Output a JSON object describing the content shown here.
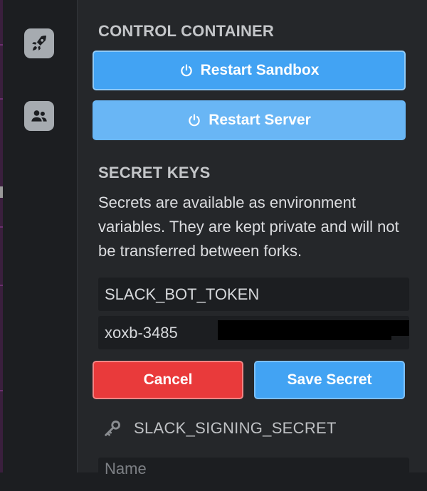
{
  "sidebar": {
    "items": [
      {
        "icon": "rocket-icon",
        "label": ""
      },
      {
        "icon": "users-icon",
        "label": ""
      }
    ]
  },
  "control_container": {
    "title": "CONTROL CONTAINER",
    "restart_sandbox_label": "Restart Sandbox",
    "restart_server_label": "Restart Server",
    "button_icon": "power-icon"
  },
  "secret_keys": {
    "title": "SECRET KEYS",
    "description": "Secrets are available as environment variables. They are kept private and will not be transferred between forks.",
    "key_value": "SLACK_BOT_TOKEN",
    "secret_value": "xoxb-3485",
    "cancel_label": "Cancel",
    "save_label": "Save Secret",
    "existing_secret_name": "SLACK_SIGNING_SECRET",
    "existing_secret_icon": "key-icon",
    "name_placeholder": "Name"
  },
  "colors": {
    "primary": "#42a3f3",
    "danger": "#e93a3b",
    "panel_bg": "#25272a"
  }
}
